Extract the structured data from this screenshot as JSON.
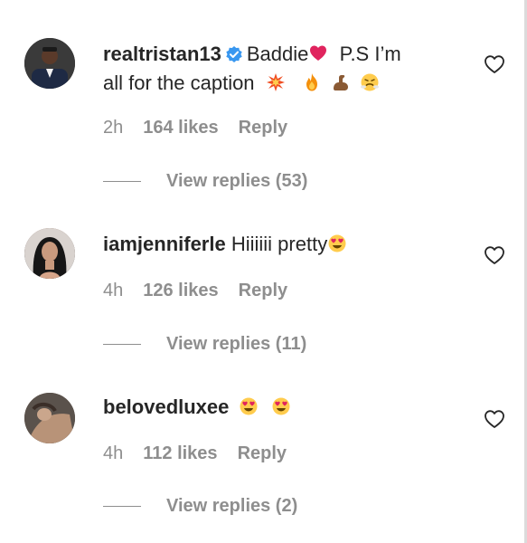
{
  "comments": [
    {
      "username": "realtristan13",
      "verified": true,
      "text_line1": "Baddie",
      "text_after_heart": "  P.S I’m",
      "text_line2": "all for the caption",
      "time": "2h",
      "likes": "164 likes",
      "reply": "Reply",
      "view_replies": "View replies (53)",
      "emojis": [
        "red-heart",
        "collision",
        "fire",
        "flexed-biceps",
        "face-with-steam"
      ]
    },
    {
      "username": "iamjenniferle",
      "verified": false,
      "text": "Hiiiiii pretty",
      "time": "4h",
      "likes": "126 likes",
      "reply": "Reply",
      "view_replies": "View replies (11)",
      "emojis": [
        "heart-eyes"
      ]
    },
    {
      "username": "belovedluxee",
      "verified": false,
      "text": "",
      "time": "4h",
      "likes": "112 likes",
      "reply": "Reply",
      "view_replies": "View replies (2)",
      "emojis": [
        "heart-eyes",
        "heart-eyes"
      ]
    }
  ],
  "colors": {
    "text": "#262626",
    "secondary": "#8e8e8e",
    "verified": "#3897f0"
  }
}
